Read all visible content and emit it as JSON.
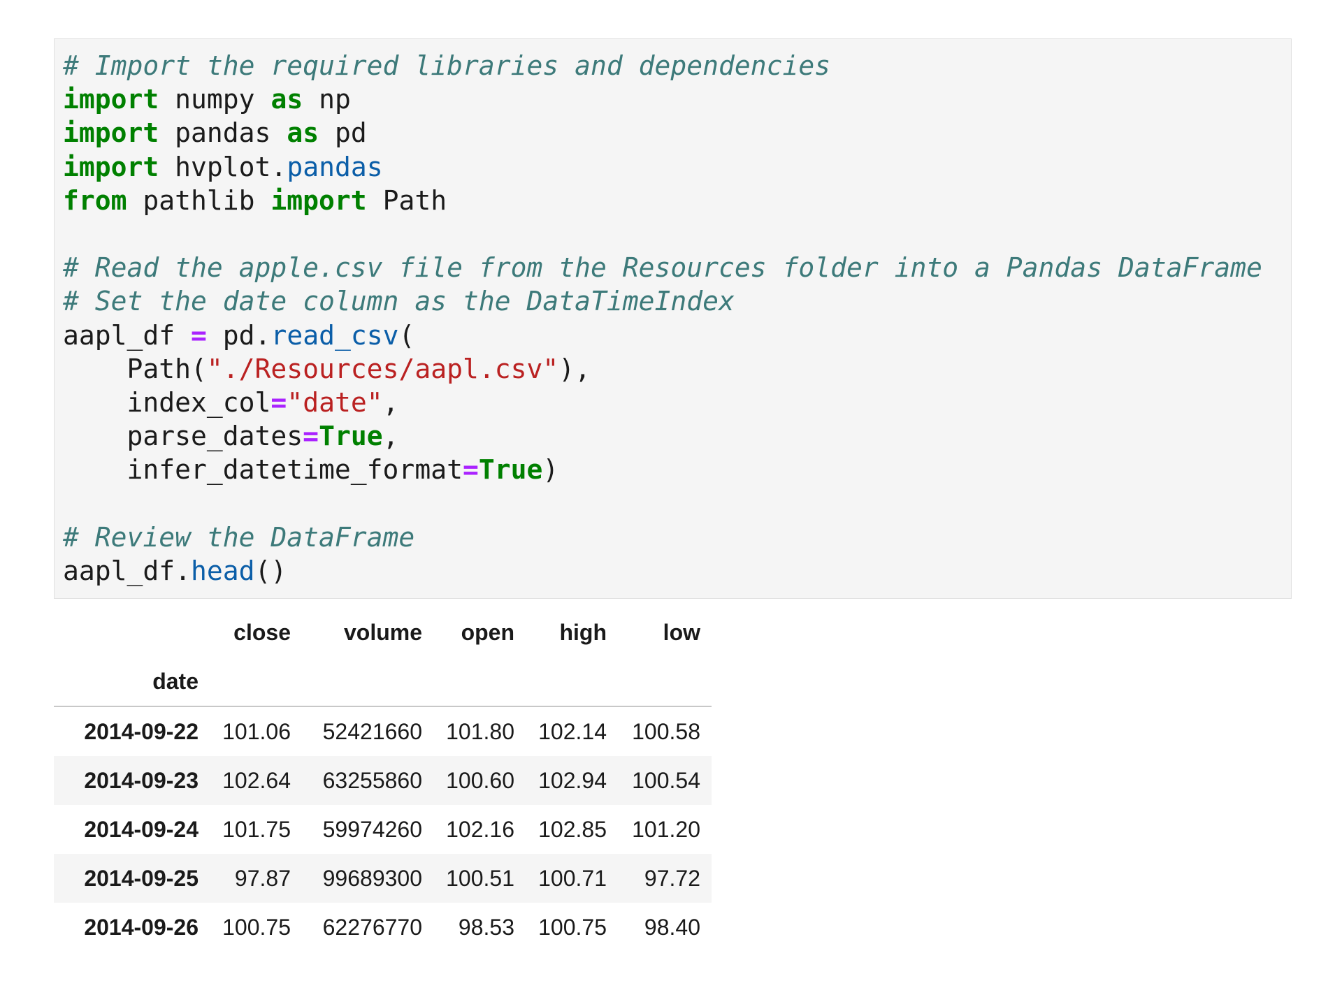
{
  "code_cell": {
    "lines": [
      [
        {
          "t": "c",
          "v": "# Import the required libraries and dependencies"
        }
      ],
      [
        {
          "t": "k",
          "v": "import"
        },
        {
          "t": "n",
          "v": " numpy "
        },
        {
          "t": "k",
          "v": "as"
        },
        {
          "t": "n",
          "v": " np"
        }
      ],
      [
        {
          "t": "k",
          "v": "import"
        },
        {
          "t": "n",
          "v": " pandas "
        },
        {
          "t": "k",
          "v": "as"
        },
        {
          "t": "n",
          "v": " pd"
        }
      ],
      [
        {
          "t": "k",
          "v": "import"
        },
        {
          "t": "n",
          "v": " hvplot."
        },
        {
          "t": "f",
          "v": "pandas"
        }
      ],
      [
        {
          "t": "k",
          "v": "from"
        },
        {
          "t": "n",
          "v": " pathlib "
        },
        {
          "t": "k",
          "v": "import"
        },
        {
          "t": "n",
          "v": " Path"
        }
      ],
      [],
      [
        {
          "t": "c",
          "v": "# Read the apple.csv file from the Resources folder into a Pandas DataFrame"
        }
      ],
      [
        {
          "t": "c",
          "v": "# Set the date column as the DataTimeIndex"
        }
      ],
      [
        {
          "t": "n",
          "v": "aapl_df "
        },
        {
          "t": "o",
          "v": "="
        },
        {
          "t": "n",
          "v": " pd."
        },
        {
          "t": "f",
          "v": "read_csv"
        },
        {
          "t": "n",
          "v": "("
        }
      ],
      [
        {
          "t": "n",
          "v": "    Path("
        },
        {
          "t": "s",
          "v": "\"./Resources/aapl.csv\""
        },
        {
          "t": "n",
          "v": "),"
        }
      ],
      [
        {
          "t": "n",
          "v": "    index_col"
        },
        {
          "t": "o",
          "v": "="
        },
        {
          "t": "s",
          "v": "\"date\""
        },
        {
          "t": "n",
          "v": ","
        }
      ],
      [
        {
          "t": "n",
          "v": "    parse_dates"
        },
        {
          "t": "o",
          "v": "="
        },
        {
          "t": "k",
          "v": "True"
        },
        {
          "t": "n",
          "v": ","
        }
      ],
      [
        {
          "t": "n",
          "v": "    infer_datetime_format"
        },
        {
          "t": "o",
          "v": "="
        },
        {
          "t": "k",
          "v": "True"
        },
        {
          "t": "n",
          "v": ")"
        }
      ],
      [],
      [
        {
          "t": "c",
          "v": "# Review the DataFrame"
        }
      ],
      [
        {
          "t": "n",
          "v": "aapl_df."
        },
        {
          "t": "f",
          "v": "head"
        },
        {
          "t": "n",
          "v": "()"
        }
      ]
    ]
  },
  "output_table": {
    "columns": [
      "close",
      "volume",
      "open",
      "high",
      "low"
    ],
    "index_name": "date",
    "rows": [
      {
        "index": "2014-09-22",
        "values": [
          "101.06",
          "52421660",
          "101.80",
          "102.14",
          "100.58"
        ]
      },
      {
        "index": "2014-09-23",
        "values": [
          "102.64",
          "63255860",
          "100.60",
          "102.94",
          "100.54"
        ]
      },
      {
        "index": "2014-09-24",
        "values": [
          "101.75",
          "59974260",
          "102.16",
          "102.85",
          "101.20"
        ]
      },
      {
        "index": "2014-09-25",
        "values": [
          "97.87",
          "99689300",
          "100.51",
          "100.71",
          "97.72"
        ]
      },
      {
        "index": "2014-09-26",
        "values": [
          "100.75",
          "62276770",
          "98.53",
          "100.75",
          "98.40"
        ]
      }
    ]
  },
  "colors": {
    "cell_background": "#f5f5f5",
    "comment": "#3d7a7a",
    "keyword": "#008000",
    "operator": "#aa22ff",
    "function": "#0b5ea8",
    "string": "#ba2121"
  }
}
